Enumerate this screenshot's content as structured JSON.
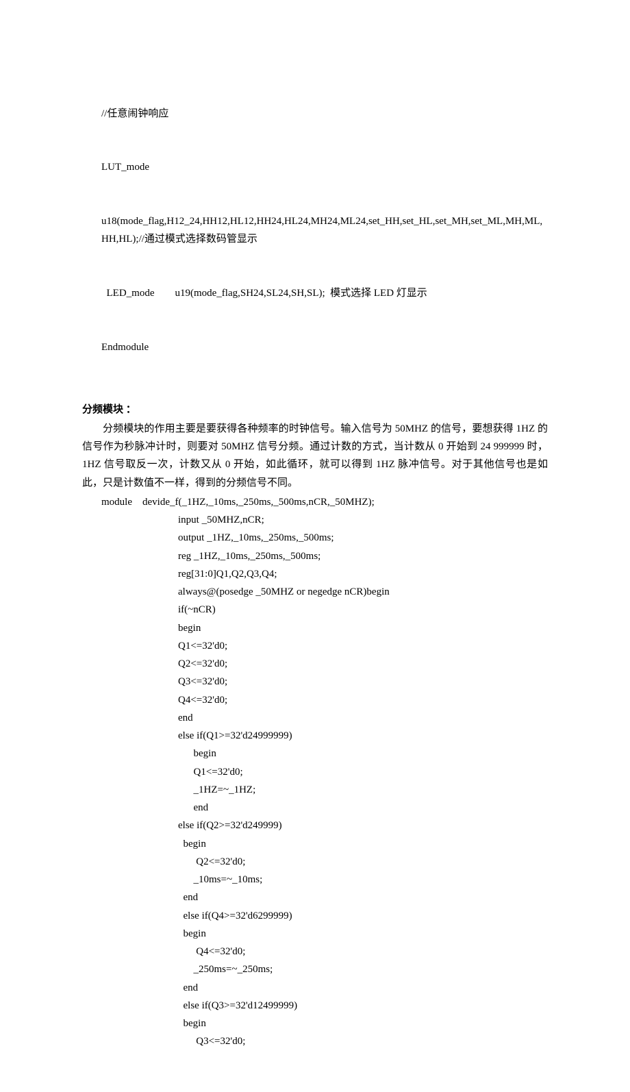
{
  "code1": {
    "l1": "//任意闹钟响应",
    "l2": "LUT_mode",
    "l3": "u18(mode_flag,H12_24,HH12,HL12,HH24,HL24,MH24,ML24,set_HH,set_HL,set_MH,set_ML,MH,ML,HH,HL);//通过模式选择数码管显示",
    "l4": "  LED_mode        u19(mode_flag,SH24,SL24,SH,SL);  模式选择 LED 灯显示",
    "l5": "Endmodule"
  },
  "heading1": "分频模块 ：",
  "para1": "分频模块的作用主要是要获得各种频率的时钟信号。输入信号为 50MHZ 的信号，要想获得 1HZ 的信号作为秒脉冲计时，则要对 50MHZ 信号分频。通过计数的方式，当计数从 0 开始到 24 999999 时，1HZ 信号取反一次，计数又从 0 开始，如此循环，就可以得到 1HZ 脉冲信号。对于其他信号也是如此，只是计数值不一样，得到的分频信号不同。",
  "code2": {
    "l1": "module    devide_f(_1HZ,_10ms,_250ms,_500ms,nCR,_50MHZ);",
    "body": "input _50MHZ,nCR;\noutput _1HZ,_10ms,_250ms,_500ms;\nreg _1HZ,_10ms,_250ms,_500ms;\nreg[31:0]Q1,Q2,Q3,Q4;\nalways@(posedge _50MHZ or negedge nCR)begin\nif(~nCR)\nbegin\nQ1<=32'd0;\nQ2<=32'd0;\nQ3<=32'd0;\nQ4<=32'd0;\nend\nelse if(Q1>=32'd24999999)\n      begin\n      Q1<=32'd0;\n      _1HZ=~_1HZ;\n      end\nelse if(Q2>=32'd249999)\n  begin\n       Q2<=32'd0;\n      _10ms=~_10ms;\n  end\n  else if(Q4>=32'd6299999)\n  begin\n       Q4<=32'd0;\n      _250ms=~_250ms;\n  end\n  else if(Q3>=32'd12499999)\n  begin\n       Q3<=32'd0;"
  }
}
